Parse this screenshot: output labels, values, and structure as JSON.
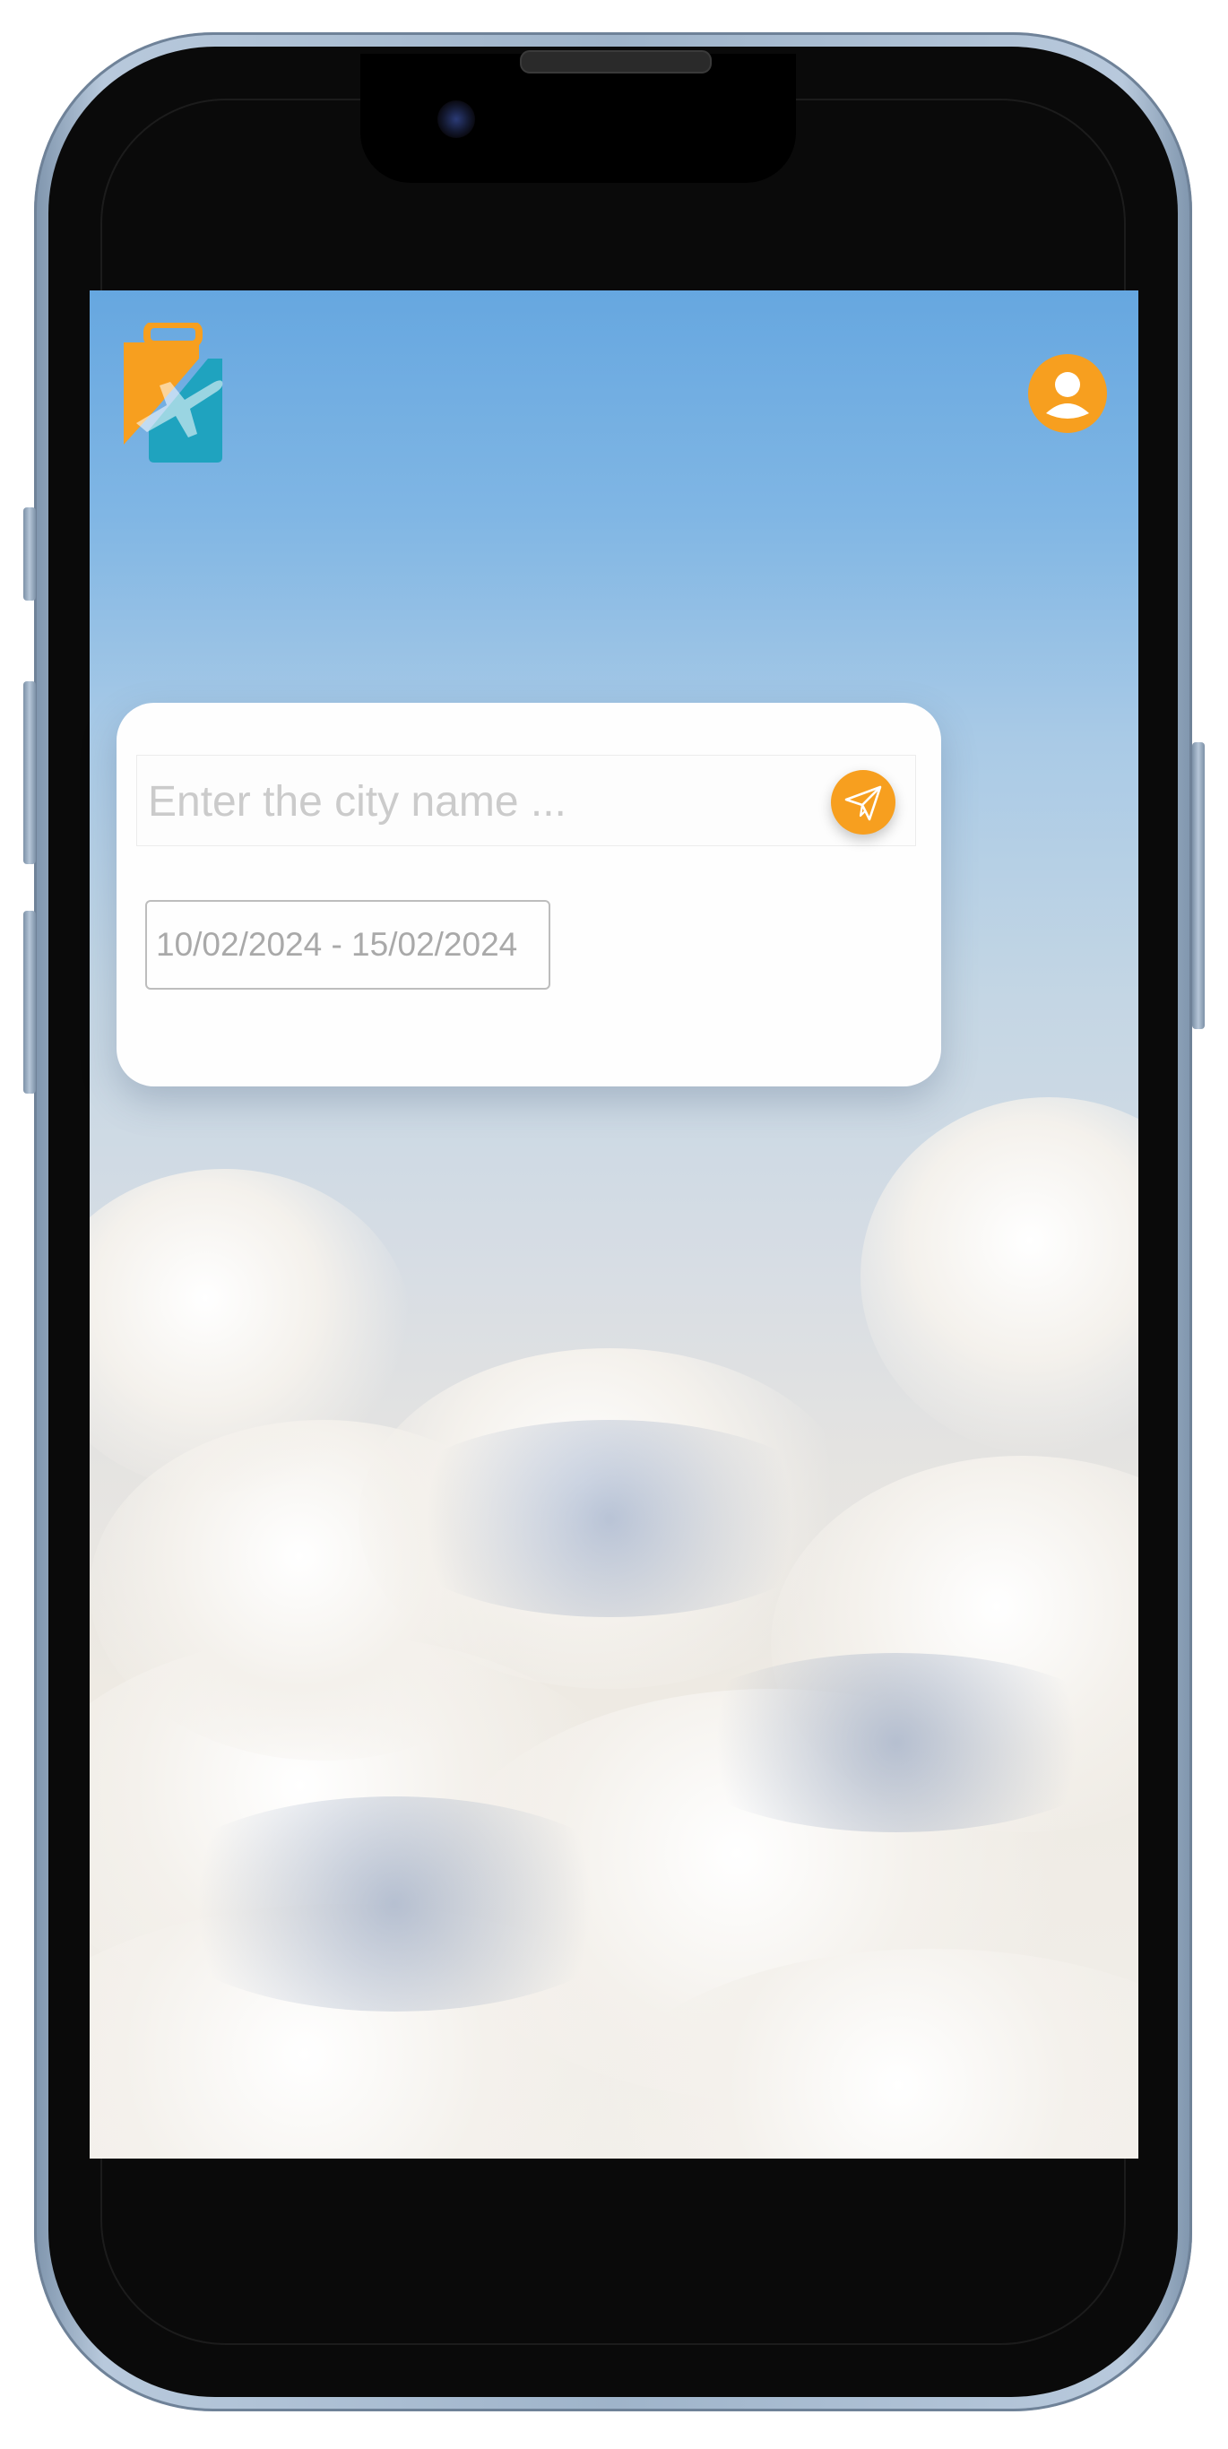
{
  "search": {
    "placeholder": "Enter the city name ...",
    "value": ""
  },
  "date_range": {
    "value": "10/02/2024 - 15/02/2024"
  },
  "icons": {
    "logo": "suitcase-airplane-logo",
    "profile": "user-avatar-icon",
    "send": "paper-plane-icon"
  },
  "colors": {
    "accent": "#f79f1f",
    "logo_teal": "#1fa3bf",
    "card_bg": "#ffffff"
  }
}
